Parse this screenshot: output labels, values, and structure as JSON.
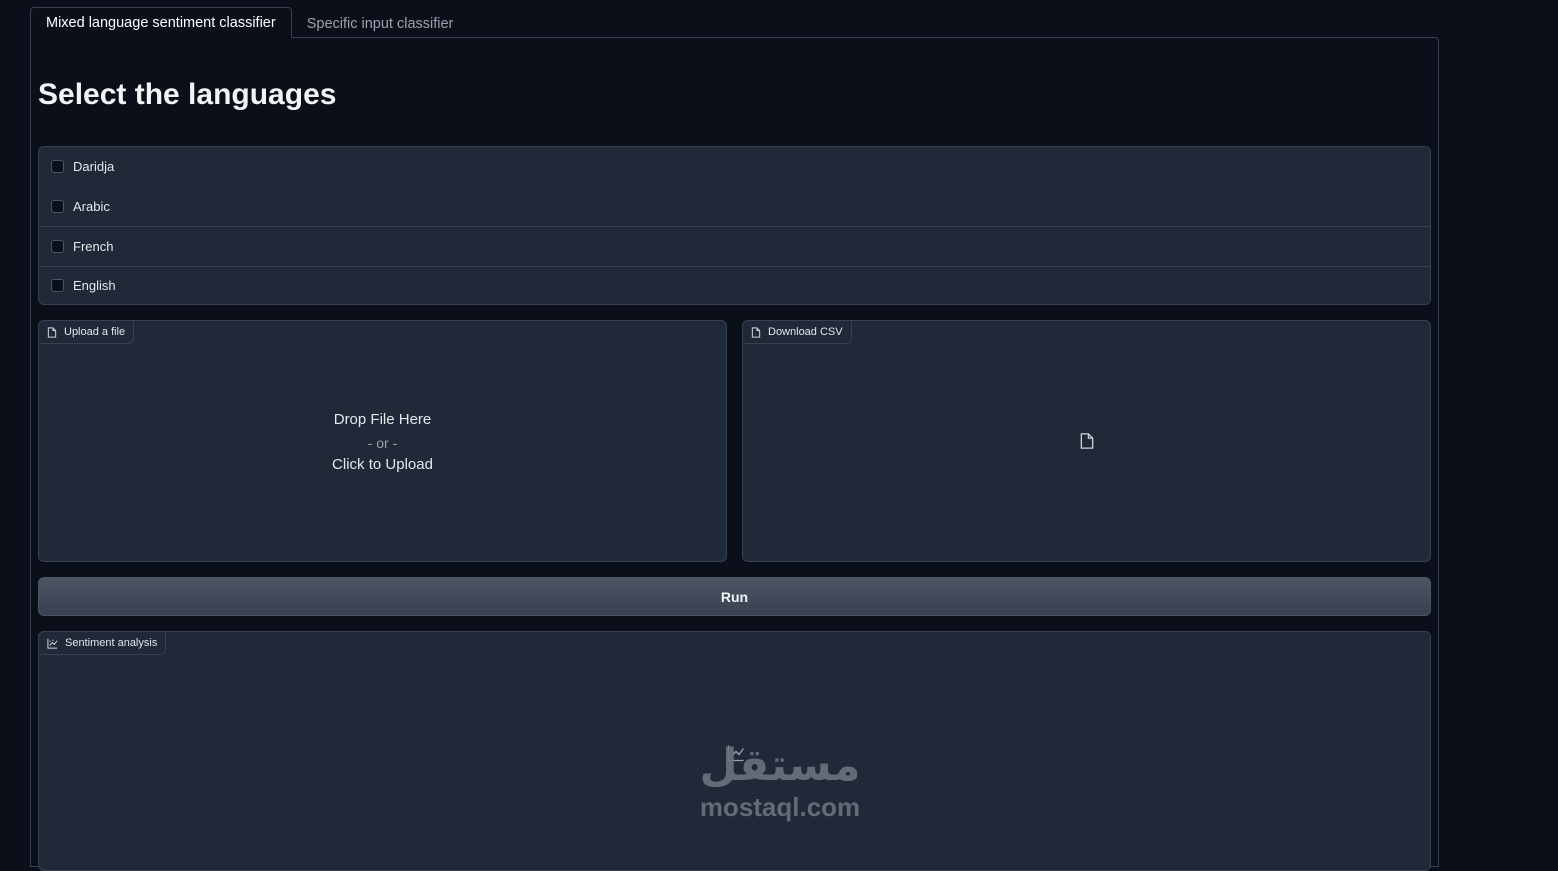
{
  "tabs": [
    {
      "label": "Mixed language sentiment classifier",
      "active": true
    },
    {
      "label": "Specific input classifier",
      "active": false
    }
  ],
  "heading": "Select the languages",
  "languages": [
    {
      "label": "Daridja",
      "checked": false
    },
    {
      "label": "Arabic",
      "checked": false
    },
    {
      "label": "French",
      "checked": false
    },
    {
      "label": "English",
      "checked": false
    }
  ],
  "upload": {
    "label": "Upload a file",
    "drop_text": "Drop File Here",
    "or_text": "- or -",
    "click_text": "Click to Upload",
    "icon": "file-icon"
  },
  "download": {
    "label": "Download CSV",
    "icon": "file-icon"
  },
  "run_button": "Run",
  "plot": {
    "label": "Sentiment analysis",
    "icon": "chart-icon"
  },
  "watermark": {
    "arabic": "مستقل",
    "latin": "mostaql.com"
  },
  "colors": {
    "background": "#0b0f19",
    "panel": "#1f2937",
    "border": "#374151"
  }
}
